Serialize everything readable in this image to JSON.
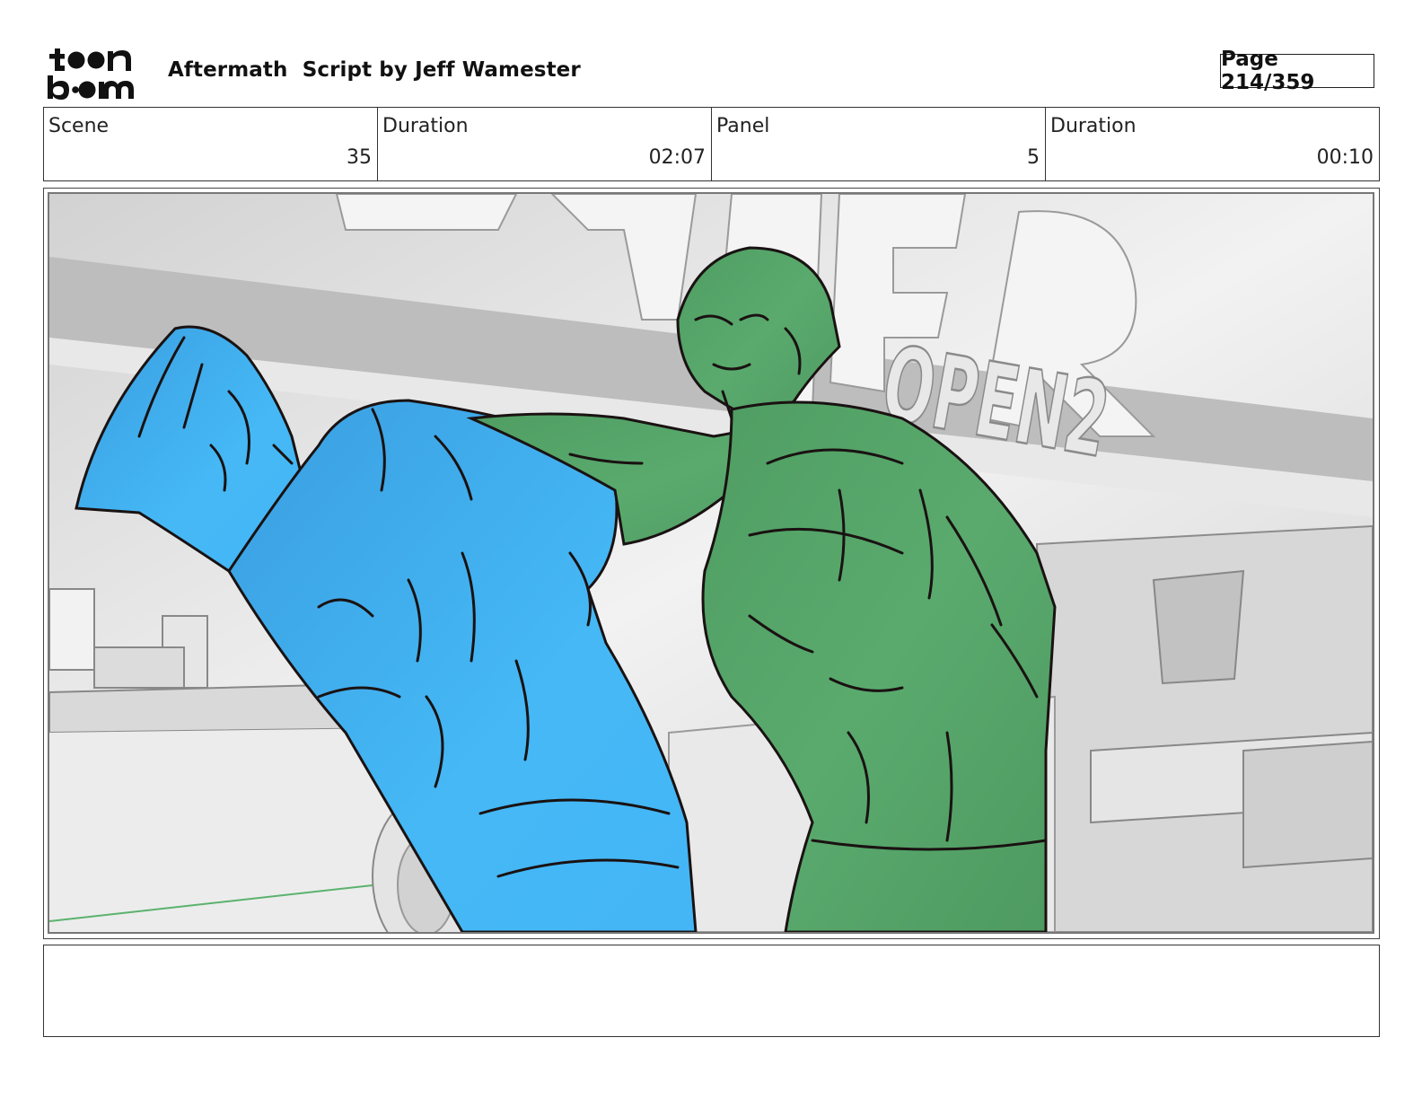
{
  "header": {
    "logo_text": "toonboom",
    "title": "Aftermath  Script by Jeff Wamester",
    "page_label": "Page 214/359"
  },
  "info": {
    "scene_label": "Scene",
    "scene_value": "35",
    "scene_duration_label": "Duration",
    "scene_duration_value": "02:07",
    "panel_label": "Panel",
    "panel_value": "5",
    "panel_duration_label": "Duration",
    "panel_duration_value": "00:10"
  },
  "panel": {
    "sign_text": "OPEN2",
    "colors": {
      "blue_character": "#45b8f5",
      "green_character": "#55a56a",
      "line": "#1a1212",
      "background": "#e2e2e2"
    }
  },
  "notes": {
    "text": ""
  }
}
